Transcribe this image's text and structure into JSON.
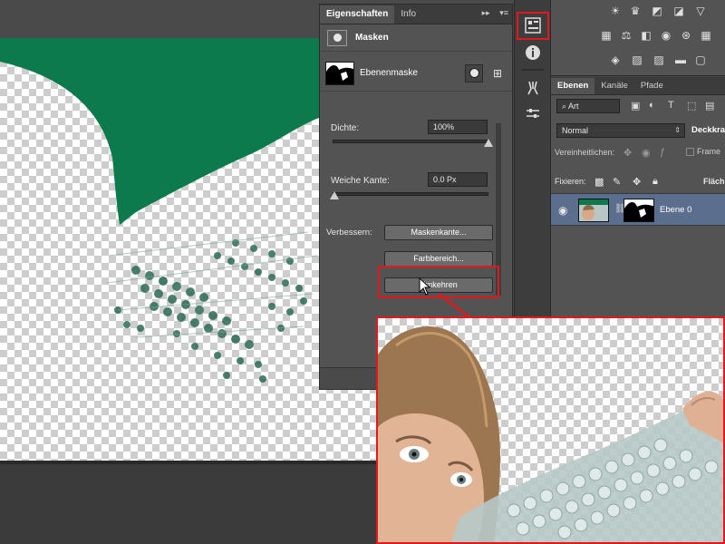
{
  "properties_panel": {
    "tabs": [
      {
        "label": "Eigenschaften",
        "active": true
      },
      {
        "label": "Info",
        "active": false
      }
    ],
    "tab_controls": {
      "collapse": "▸▸",
      "menu": "▾≡"
    },
    "section_title": "Masken",
    "mask_label": "Ebenenmaske",
    "density": {
      "label": "Dichte:",
      "value": "100%",
      "level": 1.0
    },
    "feather": {
      "label": "Weiche Kante:",
      "value": "0.0 Px",
      "level": 0.0
    },
    "refine_label": "Verbessern:",
    "buttons": {
      "mask_edge": "Maskenkante...",
      "color_range": "Farbbereich...",
      "invert": "Umkehren"
    }
  },
  "layers_panel": {
    "tabs": [
      {
        "label": "Ebenen",
        "active": true
      },
      {
        "label": "Kanäle",
        "active": false
      },
      {
        "label": "Pfade",
        "active": false
      }
    ],
    "filter_kind": "Art",
    "blend_mode": "Normal",
    "opacity_label": "Deckkra",
    "unify_label": "Vereinheitlichen:",
    "frame_label": "Frame",
    "lock_label": "Fixieren:",
    "fill_label": "Fläch",
    "layer_name": "Ebene 0"
  },
  "colors": {
    "accent_red": "#e3181c",
    "green_backdrop": "#0d7a4d",
    "panel": "#535353",
    "selected_layer": "#5c6e8e"
  }
}
